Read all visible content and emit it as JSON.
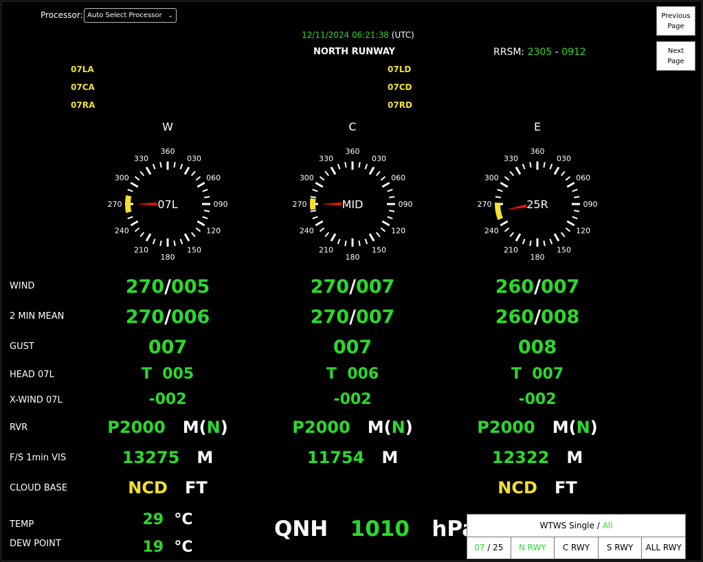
{
  "processor": {
    "label": "Processor:",
    "selected": "Auto Select Processor"
  },
  "nav": {
    "prev_l1": "Previous",
    "prev_l2": "Page",
    "next_l1": "Next",
    "next_l2": "Page"
  },
  "header": {
    "timestamp": "12/11/2024 06:21:38",
    "tz": "(UTC)",
    "runway": "NORTH RUNWAY",
    "rrsm_label": "RRSM:",
    "rrsm_a": "2305",
    "rrsm_sep": "-",
    "rrsm_b": "0912"
  },
  "codes_left": [
    "07LA",
    "07CA",
    "07RA"
  ],
  "codes_right": [
    "07LD",
    "07CD",
    "07RD"
  ],
  "ticks": [
    "360",
    "030",
    "060",
    "090",
    "120",
    "150",
    "180",
    "210",
    "240",
    "270",
    "300",
    "330"
  ],
  "columns": [
    {
      "head": "W",
      "center": "07L",
      "wind_dir": 270,
      "wind_dir_str": "270",
      "wind_spd": "005",
      "mean_dir": "270",
      "mean_spd": "006",
      "gust": "007",
      "head_t": "T",
      "head_val": "005",
      "xwind": "-002",
      "rvr": "P2000",
      "rvr_unit": "M",
      "rvr_trend": "N",
      "vis": "13275",
      "vis_unit": "M",
      "cloud": "NCD",
      "cloud_unit": "FT",
      "arc_from": 258,
      "arc_to": 282
    },
    {
      "head": "C",
      "center": "MID",
      "wind_dir": 270,
      "wind_dir_str": "270",
      "wind_spd": "007",
      "mean_dir": "270",
      "mean_spd": "007",
      "gust": "007",
      "head_t": "T",
      "head_val": "006",
      "xwind": "-002",
      "rvr": "P2000",
      "rvr_unit": "M",
      "rvr_trend": "N",
      "vis": "11754",
      "vis_unit": "M",
      "cloud": "",
      "cloud_unit": "",
      "arc_from": 262,
      "arc_to": 278
    },
    {
      "head": "E",
      "center": "25R",
      "wind_dir": 260,
      "wind_dir_str": "260",
      "wind_spd": "007",
      "mean_dir": "260",
      "mean_spd": "008",
      "gust": "008",
      "head_t": "T",
      "head_val": "007",
      "xwind": "-002",
      "rvr": "P2000",
      "rvr_unit": "M",
      "rvr_trend": "N",
      "vis": "12322",
      "vis_unit": "M",
      "cloud": "NCD",
      "cloud_unit": "FT",
      "arc_from": 248,
      "arc_to": 272
    }
  ],
  "labels": {
    "wind": "WIND",
    "mean": "2 MIN MEAN",
    "gust": "GUST",
    "head": "HEAD 07L",
    "xwind": "X-WIND 07L",
    "rvr": "RVR",
    "vis": "F/S 1min VIS",
    "cloud": "CLOUD BASE",
    "temp": "TEMP",
    "dew": "DEW POINT"
  },
  "temp": {
    "value": "29",
    "unit": "°C"
  },
  "dew": {
    "value": "19",
    "unit": "°C"
  },
  "qnh": {
    "label": "QNH",
    "value": "1010",
    "unit": "hPa"
  },
  "wtws": {
    "title": "WTWS Single /",
    "title_all": "All",
    "tab1_a": "07",
    "tab1_sep": "/ 25",
    "tab2": "N RWY",
    "tab3": "C RWY",
    "tab4": "S RWY",
    "tab5": "ALL RWY"
  },
  "colors": {
    "green": "#2bd92b",
    "yellow": "#f2e12a",
    "needle": "#e01010"
  }
}
